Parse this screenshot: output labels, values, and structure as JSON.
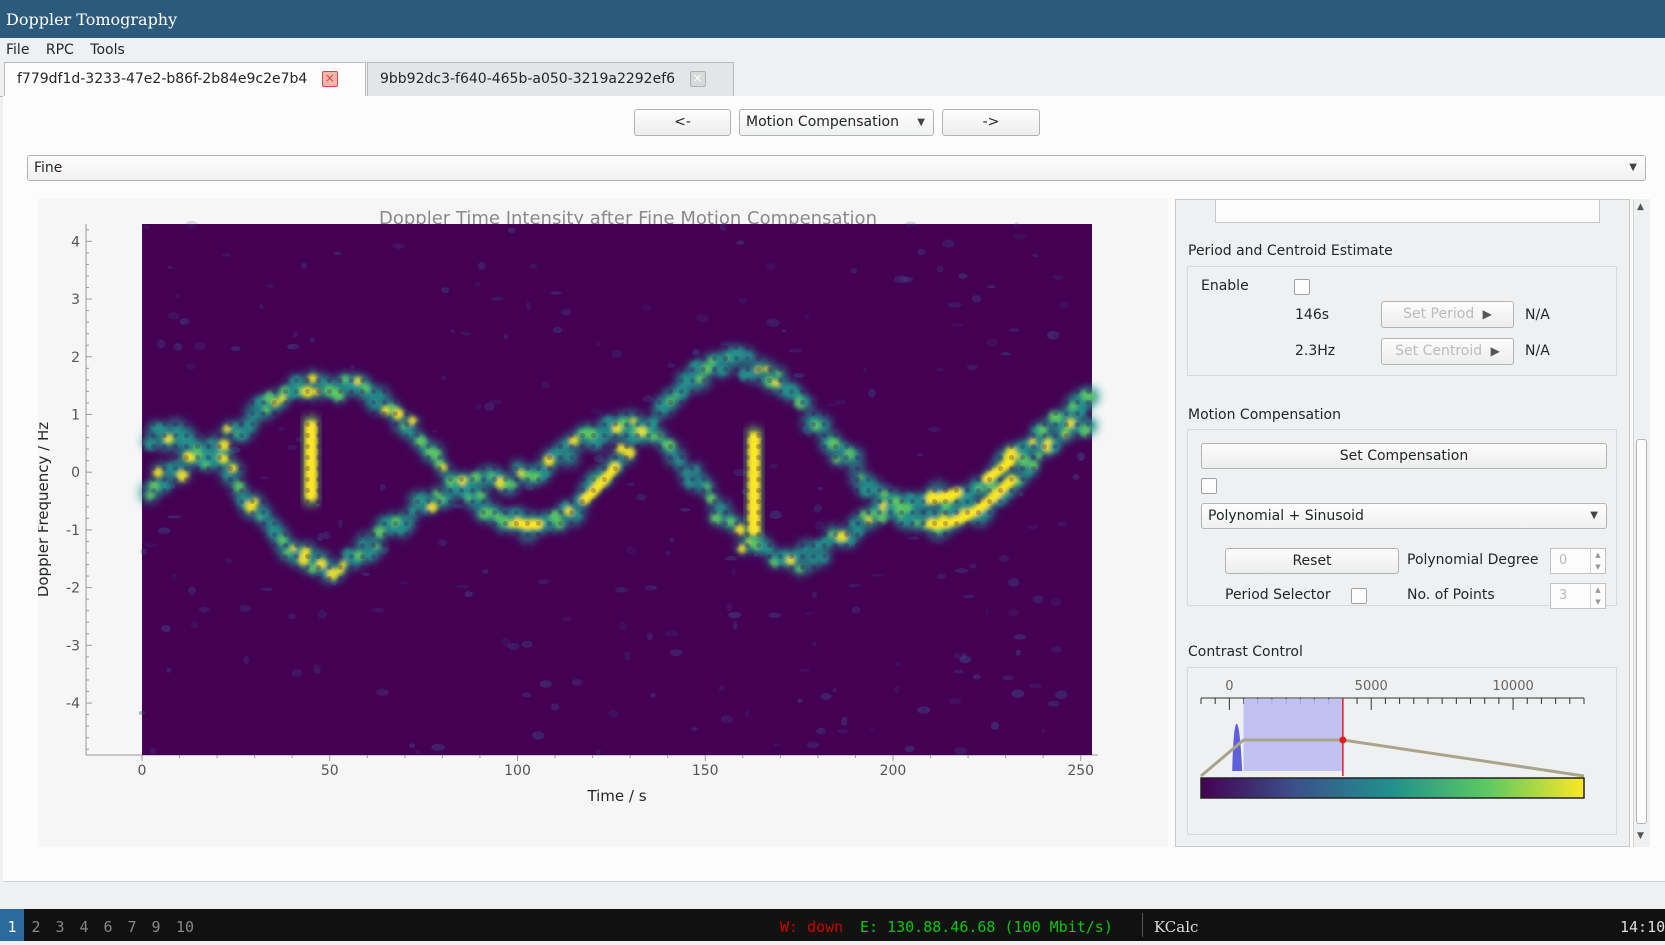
{
  "window": {
    "title": "Doppler Tomography"
  },
  "menu": [
    "File",
    "RPC",
    "Tools"
  ],
  "tabs": [
    {
      "label": "f779df1d-3233-47e2-b86f-2b84e9c2e7b4",
      "close": "×",
      "active": true
    },
    {
      "label": "9bb92dc3-f640-465b-a050-3219a2292ef6",
      "close": "×",
      "active": false
    }
  ],
  "nav": {
    "prev_label": "<-",
    "stage": "Motion Compensation",
    "next_label": "->"
  },
  "mode_combo": "Fine",
  "chart_data": {
    "type": "heatmap",
    "title": "Doppler Time Intensity after Fine Motion Compensation",
    "xlabel": "Time / s",
    "ylabel": "Doppler Frequency / Hz",
    "xlim": [
      0,
      253
    ],
    "ylim": [
      -4.9,
      4.3
    ],
    "xticks": [
      0,
      50,
      100,
      150,
      200,
      250
    ],
    "yticks": [
      -4,
      -3,
      -2,
      -1,
      0,
      1,
      2,
      3,
      4
    ],
    "colormap": "viridis",
    "colors": {
      "background": "#440154",
      "low": "#3b528b",
      "mid": "#21918c",
      "high": "#5ec962",
      "peak": "#fde725"
    },
    "features": [
      {
        "kind": "vertical-streak",
        "x": 45,
        "y_range": [
          -0.6,
          1.0
        ]
      },
      {
        "kind": "vertical-streak",
        "x": 163,
        "y_range": [
          -1.2,
          0.8
        ]
      },
      {
        "kind": "sinusoid-trace",
        "x_range": [
          0,
          253
        ],
        "y_range": [
          -1.5,
          1.6
        ]
      }
    ]
  },
  "panel": {
    "period_section": {
      "title": "Period and Centroid Estimate",
      "enable_label": "Enable",
      "period_value": "146s",
      "set_period_label": "Set Period",
      "period_result": "N/A",
      "centroid_value": "2.3Hz",
      "set_centroid_label": "Set Centroid",
      "centroid_result": "N/A"
    },
    "motion_section": {
      "title": "Motion Compensation",
      "set_compensation_label": "Set Compensation",
      "model_combo": "Polynomial + Sinusoid",
      "reset_label": "Reset",
      "poly_degree_label": "Polynomial Degree",
      "poly_degree_value": "0",
      "period_selector_label": "Period Selector",
      "points_label": "No. of Points",
      "points_value": "3"
    },
    "contrast_section": {
      "title": "Contrast Control",
      "axis_labels": [
        "0",
        "5000",
        "10000"
      ],
      "axis_values": [
        0,
        5000,
        10000
      ],
      "axis_range": [
        -1000,
        12500
      ],
      "range_min": 500,
      "range_max": 4000,
      "colormap": "viridis"
    }
  },
  "taskbar": {
    "workspaces": [
      "1",
      "2",
      "3",
      "4",
      "6",
      "7",
      "9",
      "10"
    ],
    "wifi_status": "W: down",
    "ethernet_status": "E: 130.88.46.68 (100 Mbit/s)",
    "active_window": "KCalc",
    "clock": "14:10"
  }
}
